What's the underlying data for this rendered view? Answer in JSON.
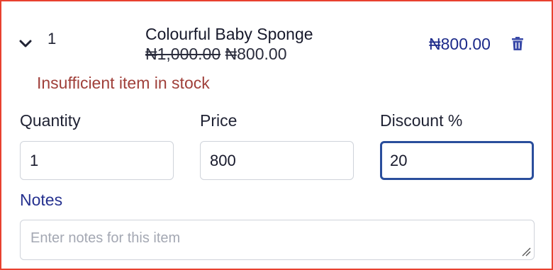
{
  "item": {
    "index": "1",
    "name": "Colourful Baby Sponge",
    "original_price": "₦1,000.00",
    "discounted_price": "₦800.00",
    "line_total": "₦800.00"
  },
  "error_message": "Insufficient item in stock",
  "fields": {
    "quantity": {
      "label": "Quantity",
      "value": "1"
    },
    "price": {
      "label": "Price",
      "value": "800"
    },
    "discount": {
      "label": "Discount %",
      "value": "20"
    }
  },
  "notes": {
    "label": "Notes",
    "placeholder": "Enter notes for this item",
    "value": ""
  },
  "colors": {
    "error_border": "#e8412f",
    "error_text": "#a0403a",
    "accent": "#1c2a8a",
    "focus_border": "#2a4e9c"
  },
  "icons": {
    "collapse": "chevron-down-icon",
    "delete": "trash-icon",
    "resize": "resize-grip-icon"
  }
}
